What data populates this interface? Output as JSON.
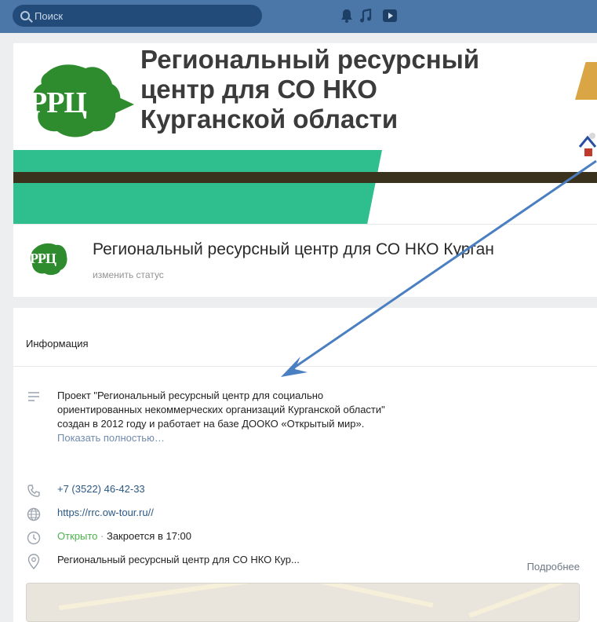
{
  "topbar": {
    "search_placeholder": "Поиск",
    "icons": [
      "search-icon",
      "bell-icon",
      "music-icon",
      "video-icon"
    ]
  },
  "cover": {
    "title_line1": "Региональный ресурсный",
    "title_line2": "центр для СО НКО",
    "title_line3": "Курганской области",
    "logo_text": "РРЦ",
    "colors": {
      "green": "#2fbf8f",
      "dark": "#3a321c",
      "logo_green": "#2e8b2e"
    }
  },
  "profile": {
    "avatar_text": "РРЦ",
    "name": "Региональный ресурсный центр для СО НКО Курган",
    "status": "изменить статус"
  },
  "info": {
    "heading": "Информация",
    "description_line1": "Проект \"Региональный ресурсный центр для социально",
    "description_line2": "ориентированных некоммерческих организаций Курганской области\"",
    "description_line3": "создан в 2012 году и работает на базе ДООКО «Открытый мир».",
    "show_more": "Показать полностью…",
    "phone": "+7 (3522) 46-42-33",
    "website": "https://rrc.ow-tour.ru//",
    "open_status": "Открыто",
    "separator": "·",
    "closes": "Закроется в 17:00",
    "address": "Региональный ресурсный центр для СО НКО Кур...",
    "details": "Подробнее"
  },
  "colors": {
    "topbar": "#4a76a8",
    "arrow": "#4a7fc1",
    "link": "#2a5885",
    "open": "#4bb34b"
  }
}
